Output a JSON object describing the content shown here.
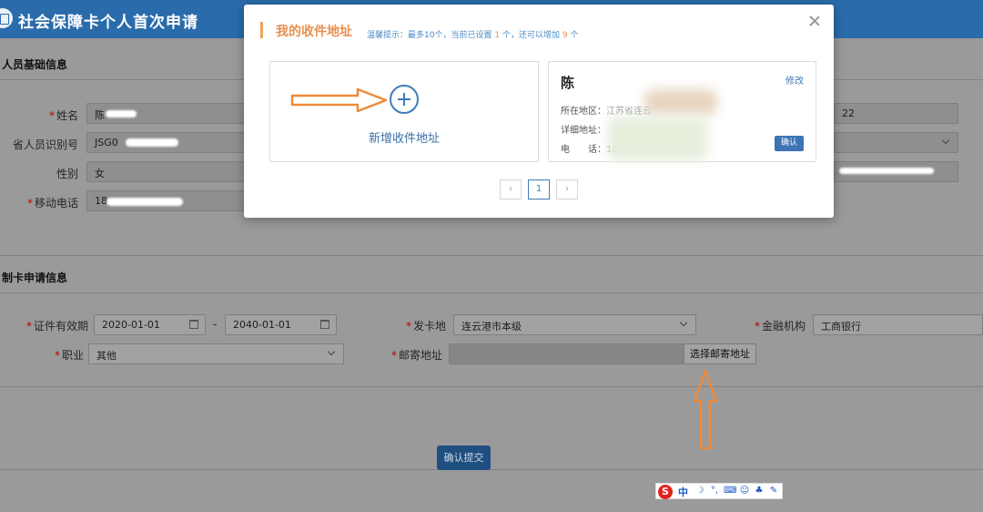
{
  "header": {
    "title": "社会保障卡个人首次申请"
  },
  "basic_section": {
    "title": "人员基础信息",
    "fields": [
      {
        "label": "姓名",
        "required": true,
        "value": "陈"
      },
      {
        "label": "省人员识别号",
        "required": false,
        "value": "JSG0"
      },
      {
        "label": "性别",
        "required": false,
        "value": "女"
      },
      {
        "label": "移动电话",
        "required": true,
        "value": "18"
      }
    ],
    "right_value": "22"
  },
  "card_section": {
    "title": "制卡申请信息",
    "validity_label": "证件有效期",
    "validity_start": "2020-01-01",
    "validity_end": "2040-01-01",
    "validity_sep": "-",
    "issue_place_label": "发卡地",
    "issue_place_value": "连云港市本级",
    "bank_label": "金融机构",
    "bank_value": "工商银行",
    "job_label": "职业",
    "job_value": "其他",
    "mail_label": "邮寄地址",
    "mail_value": "",
    "choose_mail_button": "选择邮寄地址"
  },
  "submit_button": "确认提交",
  "modal": {
    "title": "我的收件地址",
    "tip_prefix": "温馨提示：最多10个，当前已设置",
    "tip_count": "1",
    "tip_middle": "个，还可以增加",
    "tip_remaining": "9",
    "tip_suffix": "个",
    "add_label": "新增收件地址",
    "address_card": {
      "name": "陈",
      "edit_label": "修改",
      "region_label": "所在地区：",
      "region_value": "江苏省连云",
      "detail_label": "详细地址：",
      "detail_value": "",
      "phone_label": "电　　话：",
      "phone_value": "18",
      "confirm_label": "确认"
    },
    "pagination": {
      "prev": "‹",
      "current": "1",
      "next": "›"
    }
  },
  "ime": {
    "zh": "中"
  },
  "colors": {
    "header": "#2a6cab",
    "accent_orange": "#e8904f",
    "link_blue": "#3f7cb8"
  }
}
